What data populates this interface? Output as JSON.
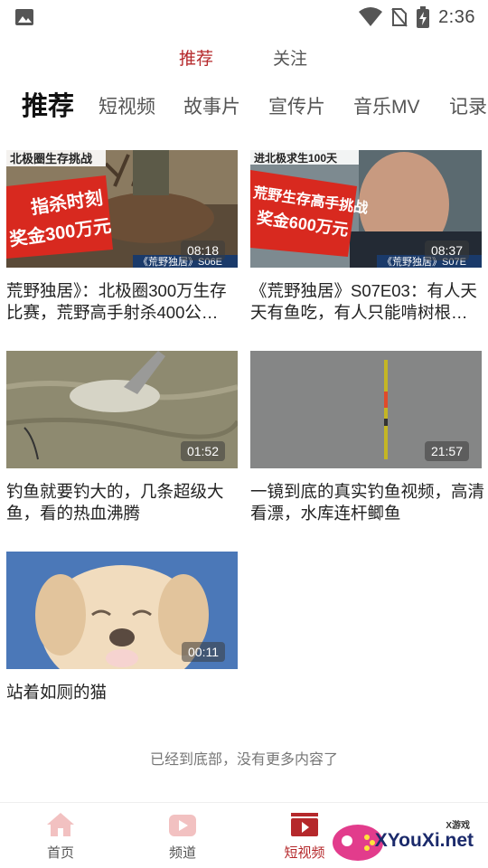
{
  "status_bar": {
    "time": "2:36"
  },
  "top_tabs": [
    {
      "label": "推荐",
      "active": true
    },
    {
      "label": "关注",
      "active": false
    }
  ],
  "categories": [
    {
      "label": "推荐",
      "active": true
    },
    {
      "label": "短视频"
    },
    {
      "label": "故事片"
    },
    {
      "label": "宣传片"
    },
    {
      "label": "音乐MV"
    },
    {
      "label": "记录"
    }
  ],
  "videos": [
    {
      "duration": "08:18",
      "title": "荒野独居》：北极圈300万生存比赛，荒野高手射杀400公…",
      "thumb_text": [
        "指杀时刻",
        "奖金300万元"
      ],
      "thumb_top": "北极圈生存挑战",
      "thumb_sub": "《荒野独居》S06E"
    },
    {
      "duration": "08:37",
      "title": "《荒野独居》S07E03：有人天天有鱼吃，有人只能啃树根…",
      "thumb_text": [
        "荒野生存高手挑战",
        "奖金600万元"
      ],
      "thumb_top": "进北极求生100天",
      "thumb_sub": "《荒野独居》S07E"
    },
    {
      "duration": "01:52",
      "title": "钓鱼就要钓大的，几条超级大鱼，看的热血沸腾"
    },
    {
      "duration": "21:57",
      "title": "一镜到底的真实钓鱼视频，高清看漂，水库连杆鲫鱼"
    },
    {
      "duration": "00:11",
      "title": "站着如厕的猫"
    }
  ],
  "end_note": "已经到底部，没有更多内容了",
  "bottom_nav": [
    {
      "label": "首页",
      "icon": "home-icon",
      "active": false
    },
    {
      "label": "频道",
      "icon": "channel-icon",
      "active": false
    },
    {
      "label": "短视频",
      "icon": "short-video-icon",
      "active": true
    }
  ],
  "watermark": {
    "text": "XYouXi.net",
    "small": "X游戏"
  },
  "colors": {
    "accent": "#b5282b",
    "inactive_icon": "#f2c1c1"
  }
}
